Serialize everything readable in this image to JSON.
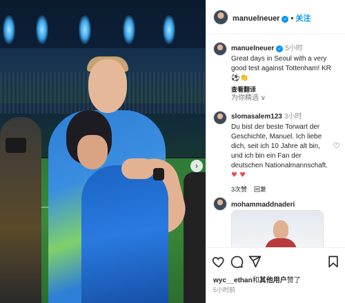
{
  "header": {
    "username": "manuelneuer",
    "verified_mark": "✓",
    "separator": "•",
    "follow_label": "关注"
  },
  "photo": {
    "next_arrow": "›"
  },
  "caption": {
    "username": "manuelneuer",
    "time": "5小时",
    "text": "Great days in Seoul with a very good test against Tottenham! KR⚽👏",
    "translate_label": "查看翻译"
  },
  "selected_label": "为你精选 ∨",
  "comments": [
    {
      "username": "slomasalem123",
      "time": "3小时",
      "text": "Du bist der beste Torwart der Geschichte, Manuel. Ich liebe dich, seit ich 10 Jahre alt bin, und ich bin ein Fan der deutschen Nationalmannschaft.",
      "hearts": "♥ ♥",
      "likes": "3次赞",
      "reply_label": "回复"
    },
    {
      "username": "mohammaddnaderi"
    }
  ],
  "actions": {
    "liked_by_user": "wyc__ethan",
    "liked_by_suffix": "和",
    "liked_by_others": "其他用户",
    "liked_tail": "赞了",
    "time": "5小时前"
  },
  "icons": [
    "like-heart-icon",
    "comment-icon",
    "share-icon",
    "bookmark-icon",
    "verified-badge-icon",
    "comment-like-icon",
    "carousel-next-icon"
  ]
}
